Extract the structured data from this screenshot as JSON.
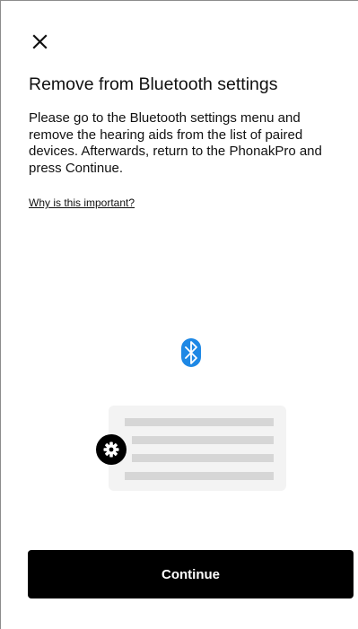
{
  "header": {
    "close_icon": "close-icon"
  },
  "content": {
    "title": "Remove from Bluetooth settings",
    "body": "Please go to the Bluetooth settings menu and remove the hearing aids from the list of paired devices. Afterwards, return to the PhonakPro and press Continue.",
    "why_link": "Why is this important?"
  },
  "illustration": {
    "bluetooth_icon": "bluetooth-icon",
    "settings_icon": "gear-icon",
    "bluetooth_color": "#1e88e5",
    "panel_color": "#f3f3f3",
    "line_color": "#d6d6d6"
  },
  "footer": {
    "continue_label": "Continue"
  },
  "colors": {
    "primary_button": "#000000",
    "text": "#111111"
  }
}
